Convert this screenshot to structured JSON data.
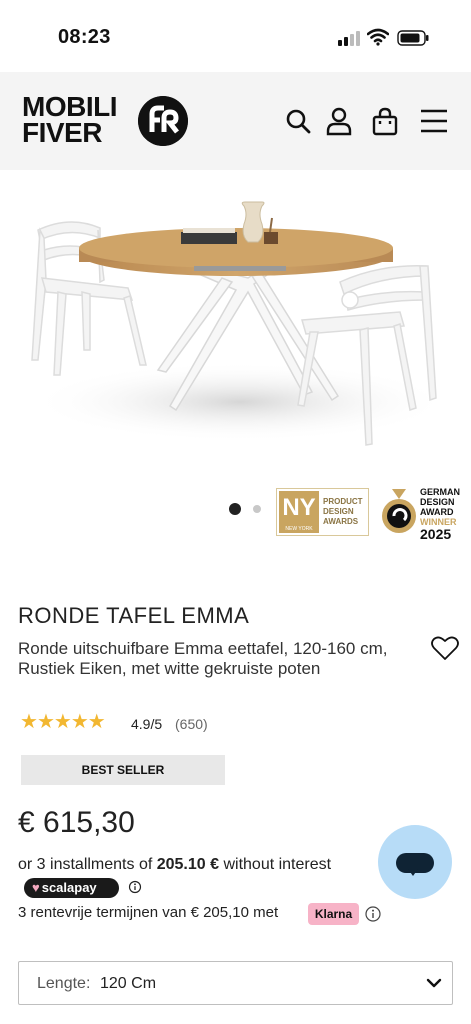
{
  "status": {
    "time": "08:23"
  },
  "header": {
    "logo_line1": "MOBILI",
    "logo_line2": "FIVER",
    "icons": [
      "search-icon",
      "account-icon",
      "cart-icon",
      "menu-icon"
    ]
  },
  "gallery": {
    "total_slides": 2,
    "active_slide": 1,
    "awards": {
      "ny": {
        "mark": "NY",
        "mark_sub": "NEW YORK",
        "lines": [
          "PRODUCT",
          "DESIGN",
          "AWARDS"
        ]
      },
      "german": {
        "lines": [
          "GERMAN",
          "DESIGN",
          "AWARD",
          "WINNER"
        ],
        "year": "2025"
      }
    }
  },
  "product": {
    "title": "RONDE TAFEL EMMA",
    "subtitle": "Ronde uitschuifbare Emma eettafel, 120-160 cm, Rustiek Eiken, met witte gekruiste poten",
    "rating": "4.9/5",
    "reviews": "(650)",
    "stars": 5,
    "badge": "BEST SELLER",
    "price": "€ 615,30"
  },
  "payment": {
    "installments_prefix": "or 3 installments of ",
    "installments_amount": "205.10 €",
    "installments_suffix": " without interest",
    "scalapay_label": "scalapay",
    "rente_text": "3 rentevrije termijnen van € 205,10 met",
    "klarna_label": "Klarna"
  },
  "options": {
    "length_label": "Lengte:",
    "length_value": "120 Cm"
  },
  "colors": {
    "star": "#f2b731",
    "klarna_pink": "#f7b3c7",
    "chat_bubble": "#b7dcf7",
    "award_gold": "#c9a560"
  }
}
